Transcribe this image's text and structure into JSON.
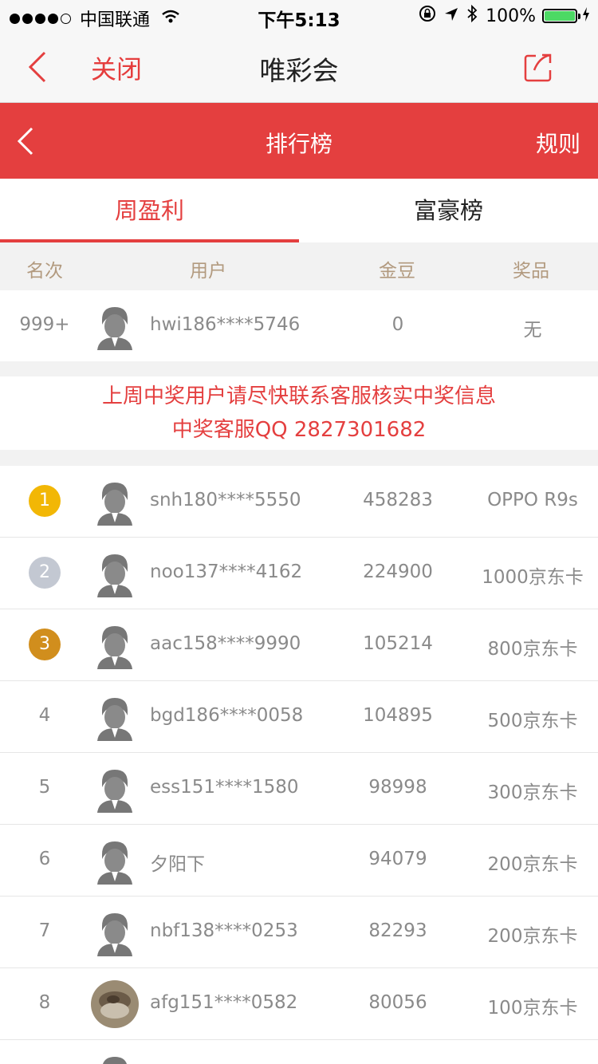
{
  "status_bar": {
    "carrier": "中国联通",
    "time": "下午5:13",
    "battery": "100%",
    "battery_level": 1.0
  },
  "nav": {
    "close_label": "关闭",
    "title": "唯彩会"
  },
  "header": {
    "title": "排行榜",
    "rules_label": "规则"
  },
  "tabs": [
    {
      "label": "周盈利",
      "active": true
    },
    {
      "label": "富豪榜",
      "active": false
    }
  ],
  "columns": {
    "rank": "名次",
    "user": "用户",
    "beans": "金豆",
    "prize": "奖品"
  },
  "my_row": {
    "rank": "999+",
    "user": "hwi186****5746",
    "beans": "0",
    "prize": "无"
  },
  "notice": {
    "line1": "上周中奖用户请尽快联系客服核实中奖信息",
    "line2": "中奖客服QQ 2827301682"
  },
  "ranking": [
    {
      "rank": "1",
      "user": "snh180****5550",
      "beans": "458283",
      "prize": "OPPO R9s"
    },
    {
      "rank": "2",
      "user": "noo137****4162",
      "beans": "224900",
      "prize": "1000京东卡"
    },
    {
      "rank": "3",
      "user": "aac158****9990",
      "beans": "105214",
      "prize": "800京东卡"
    },
    {
      "rank": "4",
      "user": "bgd186****0058",
      "beans": "104895",
      "prize": "500京东卡"
    },
    {
      "rank": "5",
      "user": "ess151****1580",
      "beans": "98998",
      "prize": "300京东卡"
    },
    {
      "rank": "6",
      "user": "夕阳下",
      "beans": "94079",
      "prize": "200京东卡"
    },
    {
      "rank": "7",
      "user": "nbf138****0253",
      "beans": "82293",
      "prize": "200京东卡"
    },
    {
      "rank": "8",
      "user": "afg151****0582",
      "beans": "80056",
      "prize": "100京东卡"
    }
  ],
  "colors": {
    "accent": "#e43f3f",
    "gold": "#f2b705",
    "silver": "#c3c8d2",
    "bronze": "#d18e1d"
  }
}
